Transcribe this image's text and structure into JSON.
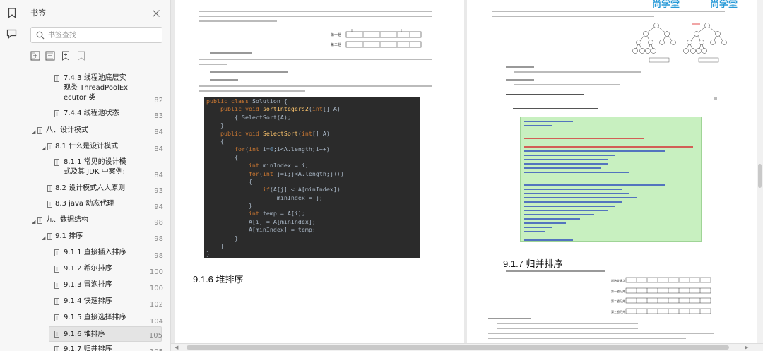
{
  "sidebar": {
    "title": "书签",
    "search_placeholder": "书签查找",
    "icons": [
      "bookmark-icon",
      "comment-icon"
    ],
    "tools": [
      "expand-all-icon",
      "collapse-all-icon",
      "add-bookmark-icon",
      "bookmark-outline-icon"
    ]
  },
  "toc": [
    {
      "label": "7.4.3 线程池底层实\n现类 ThreadPoolEx\necutor 类",
      "page": "82",
      "level": 3,
      "type": "doc"
    },
    {
      "label": "7.4.4 线程池状态",
      "page": "83",
      "level": 3,
      "type": "doc"
    },
    {
      "label": "八、设计模式",
      "page": "84",
      "level": 1,
      "type": "folder"
    },
    {
      "label": "8.1 什么是设计模式",
      "page": "84",
      "level": 2,
      "type": "folder"
    },
    {
      "label": "8.1.1 常见的设计模\n式及其 JDK 中案例:",
      "page": "84",
      "level": 3,
      "type": "doc"
    },
    {
      "label": "8.2 设计模式六大原则",
      "page": "93",
      "level": 2,
      "type": "doc"
    },
    {
      "label": "8.3 java 动态代理",
      "page": "94",
      "level": 2,
      "type": "doc"
    },
    {
      "label": "九、数据结构",
      "page": "98",
      "level": 1,
      "type": "folder"
    },
    {
      "label": "9.1 排序",
      "page": "98",
      "level": 2,
      "type": "folder"
    },
    {
      "label": "9.1.1 直接插入排序",
      "page": "98",
      "level": 3,
      "type": "doc"
    },
    {
      "label": "9.1.2 希尔排序",
      "page": "100",
      "level": 3,
      "type": "doc"
    },
    {
      "label": "9.1.3 冒泡排序",
      "page": "100",
      "level": 3,
      "type": "doc"
    },
    {
      "label": "9.1.4 快速排序",
      "page": "102",
      "level": 3,
      "type": "doc"
    },
    {
      "label": "9.1.5 直接选择排序",
      "page": "104",
      "level": 3,
      "type": "doc"
    },
    {
      "label": "9.1.6 堆排序",
      "page": "105",
      "level": 3,
      "type": "doc",
      "selected": true
    },
    {
      "label": "9.1.7 归并排序",
      "page": "105",
      "level": 3,
      "type": "doc"
    }
  ],
  "page_left": {
    "code_lines": [
      [
        [
          "kw",
          "public class "
        ],
        [
          "pl",
          "Solution {"
        ]
      ],
      [
        [
          "kw",
          "    public void "
        ],
        [
          "fn",
          "sortIntegers2"
        ],
        [
          "pl",
          "("
        ],
        [
          "kw",
          "int"
        ],
        [
          "pl",
          "[] A)"
        ]
      ],
      [
        [
          "pl",
          "        { SelectSort(A);"
        ]
      ],
      [
        [
          "pl",
          "    }"
        ]
      ],
      [
        [
          "kw",
          "    public void "
        ],
        [
          "fn",
          "SelectSort"
        ],
        [
          "pl",
          "("
        ],
        [
          "kw",
          "int"
        ],
        [
          "pl",
          "[] A)"
        ]
      ],
      [
        [
          "pl",
          "    {"
        ]
      ],
      [
        [
          "kw",
          "        for"
        ],
        [
          "pl",
          "("
        ],
        [
          "kw",
          "int "
        ],
        [
          "pl",
          "i="
        ],
        [
          "nm",
          "0"
        ],
        [
          "pl",
          ";i<A.length;i++)"
        ]
      ],
      [
        [
          "pl",
          "        {"
        ]
      ],
      [
        [
          "kw",
          "            int "
        ],
        [
          "pl",
          "minIndex = i;"
        ]
      ],
      [
        [
          "kw",
          "            for"
        ],
        [
          "pl",
          "("
        ],
        [
          "kw",
          "int "
        ],
        [
          "pl",
          "j=i;j<A.length;j++)"
        ]
      ],
      [
        [
          "pl",
          "            {"
        ]
      ],
      [
        [
          "kw",
          "                if"
        ],
        [
          "pl",
          "(A[j] < A[minIndex])"
        ]
      ],
      [
        [
          "pl",
          "                    minIndex = j;"
        ]
      ],
      [
        [
          "pl",
          "            }"
        ]
      ],
      [
        [
          "kw",
          "            int "
        ],
        [
          "pl",
          "temp = A[i];"
        ]
      ],
      [
        [
          "pl",
          "            A[i] = A[minIndex];"
        ]
      ],
      [
        [
          "pl",
          "            A[minIndex] = temp;"
        ]
      ],
      [
        [
          "pl",
          "        }"
        ]
      ],
      [
        [
          "pl",
          "    }"
        ]
      ],
      [
        [
          "pl",
          "}"
        ]
      ]
    ],
    "heading": "9.1.6 堆排序"
  },
  "page_right": {
    "heading": "9.1.7 归并排序",
    "logo_text": "尚学堂"
  }
}
